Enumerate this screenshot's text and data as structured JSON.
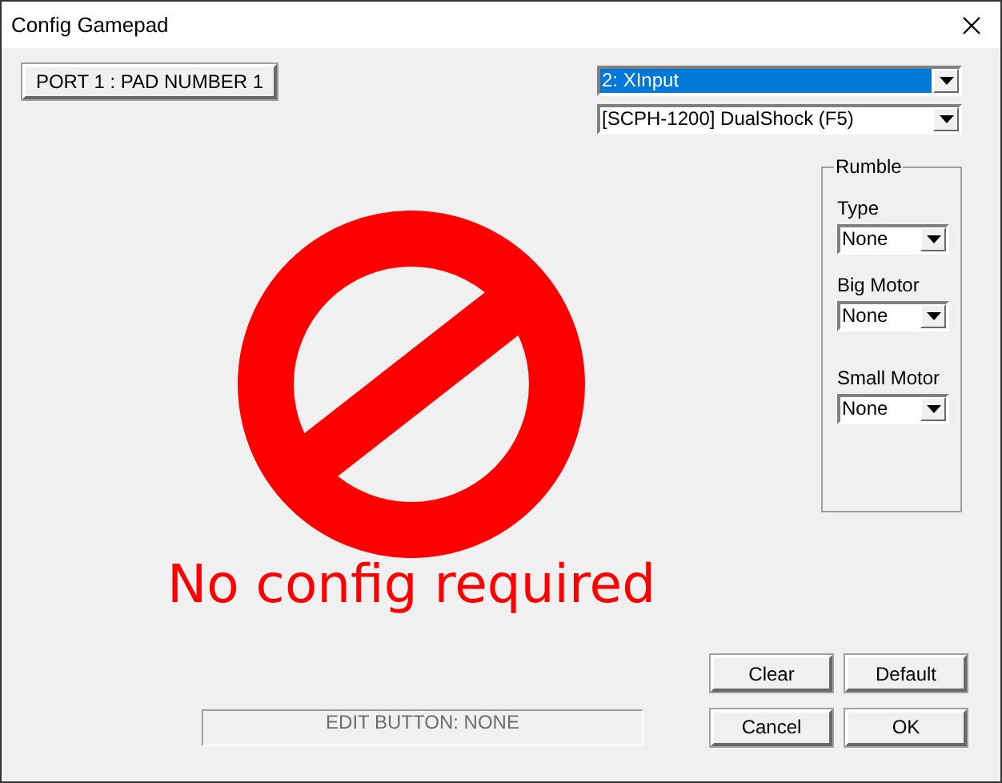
{
  "window": {
    "title": "Config Gamepad"
  },
  "port_button": "PORT 1 : PAD NUMBER 1",
  "api_select": {
    "value": "2: XInput",
    "highlighted": true
  },
  "controller_select": {
    "value": "[SCPH-1200] DualShock (F5)",
    "highlighted": false
  },
  "message": "No config required",
  "rumble": {
    "title": "Rumble",
    "fields": [
      {
        "label": "Type",
        "value": "None"
      },
      {
        "label": "Big Motor",
        "value": "None"
      },
      {
        "label": "Small Motor",
        "value": "None"
      }
    ]
  },
  "status": "EDIT BUTTON: NONE",
  "buttons": [
    "Clear",
    "Default",
    "Cancel",
    "OK"
  ]
}
